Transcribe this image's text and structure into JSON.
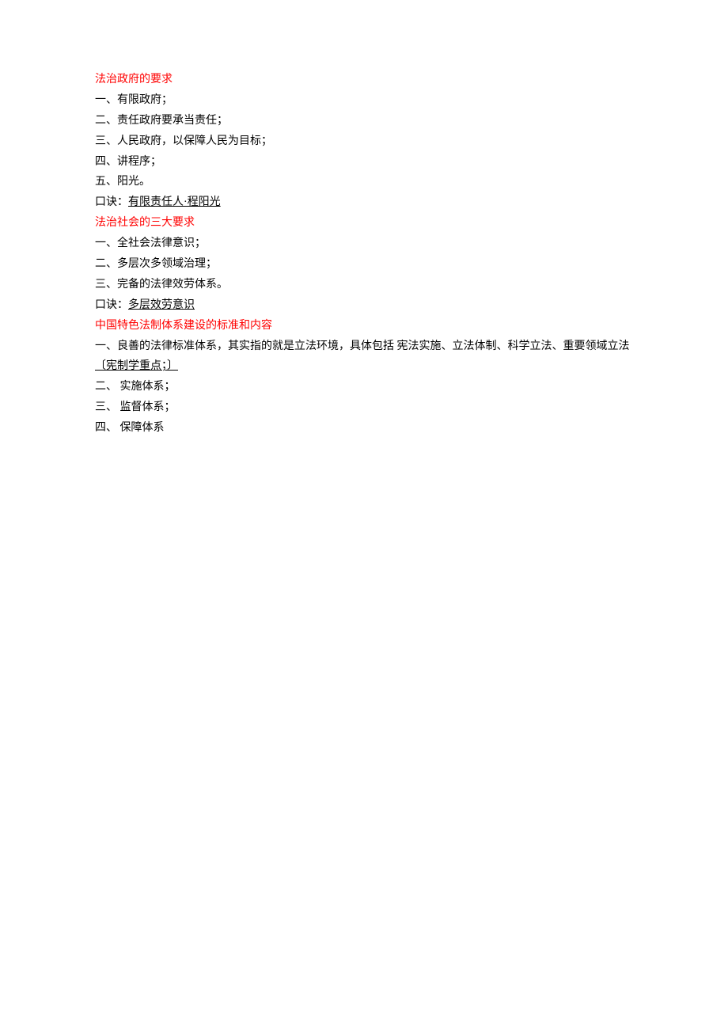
{
  "section1": {
    "heading": "法治政府的要求",
    "items": [
      "一、有限政府；",
      "二、责任政府要承当责任；",
      "三、人民政府，以保障人民为目标；",
      "四、讲程序；",
      "五、阳光。"
    ],
    "mnemonic_prefix": "口诀：",
    "mnemonic": "有限责任人·程阳光"
  },
  "section2": {
    "heading": "法治社会的三大要求",
    "items": [
      "一、全社会法律意识；",
      "二、多层次多领域治理；",
      "三、完备的法律效劳体系。"
    ],
    "mnemonic_prefix": "口诀：",
    "mnemonic": "多层效劳意识"
  },
  "section3": {
    "heading": "中国特色法制体系建设的标准和内容",
    "item1_prefix": "一、良善的法律标准体系，其实指的就是立法环境，具体包括 宪法实施、立法体制、科学立法、重要领域立法",
    "item1_underlined": "〔宪制学重点；〕",
    "item2": "二、 实施体系；",
    "item3": "三、  监督体系；",
    "item4": "四、  保障体系"
  }
}
